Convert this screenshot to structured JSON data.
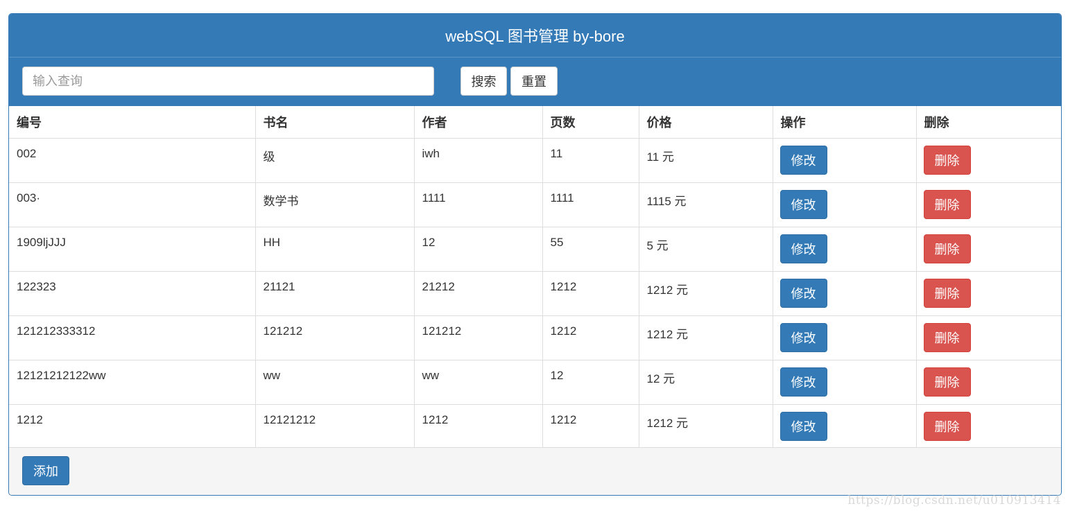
{
  "header": {
    "title": "webSQL 图书管理 by-bore"
  },
  "toolbar": {
    "search_placeholder": "输入查询",
    "search_value": "",
    "search_label": "搜索",
    "reset_label": "重置"
  },
  "table": {
    "columns": [
      "编号",
      "书名",
      "作者",
      "页数",
      "价格",
      "操作",
      "删除"
    ],
    "edit_label": "修改",
    "delete_label": "删除",
    "rows": [
      {
        "id": "002",
        "name": "级",
        "author": "iwh",
        "pages": "11",
        "price": "11 元"
      },
      {
        "id": "003·",
        "name": "数学书",
        "author": "1111",
        "pages": "1111",
        "price": "1115 元"
      },
      {
        "id": "1909ljJJJ",
        "name": "HH",
        "author": "12",
        "pages": "55",
        "price": "5 元"
      },
      {
        "id": "122323",
        "name": "21121",
        "author": "21212",
        "pages": "1212",
        "price": "1212 元"
      },
      {
        "id": "121212333312",
        "name": "121212",
        "author": "121212",
        "pages": "1212",
        "price": "1212 元"
      },
      {
        "id": "12121212122ww",
        "name": "ww",
        "author": "ww",
        "pages": "12",
        "price": "12 元"
      },
      {
        "id": "1212",
        "name": "12121212",
        "author": "1212",
        "pages": "1212",
        "price": "1212 元"
      }
    ]
  },
  "footer": {
    "add_label": "添加"
  },
  "watermark": "https://blog.csdn.net/u010913414",
  "colors": {
    "primary": "#337ab7",
    "danger": "#d9534f",
    "footer_bg": "#f5f5f5"
  }
}
